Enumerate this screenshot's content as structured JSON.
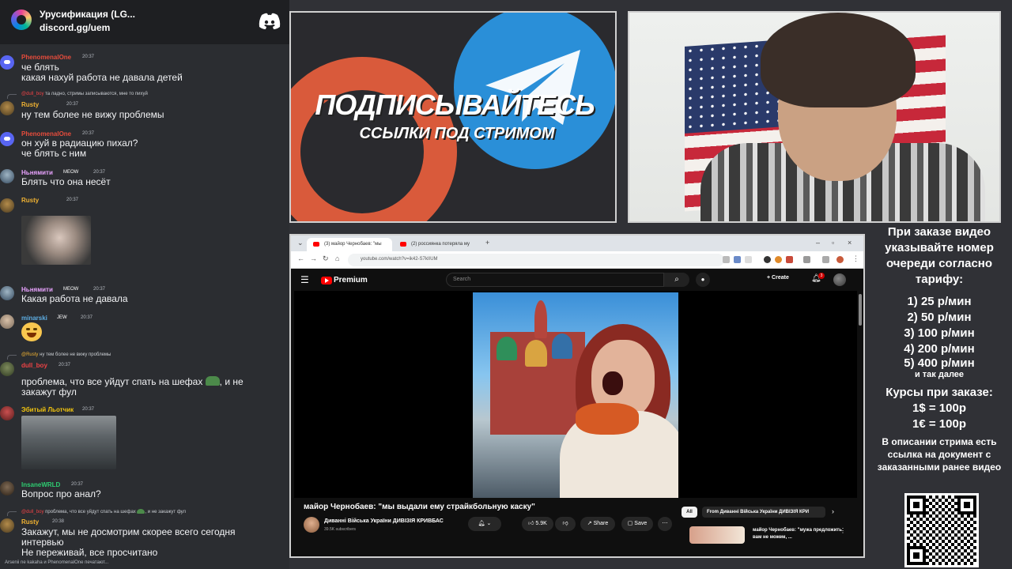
{
  "chat": {
    "server_name": "Урусификация (LG...",
    "server_link": "discord.gg/uem",
    "messages": [
      {
        "user": "PhenomenalOne",
        "time": "20:37",
        "lines": "че блять\nкакая нахуй работа не давала детей"
      },
      {
        "reply_user": "@dull_boy",
        "reply_text": "та ладно, стримы записываются, мне то пихуй",
        "user": "Rusty",
        "time": "20:37",
        "lines": "ну тем более не вижу проблемы"
      },
      {
        "user": "PhenomenalOne",
        "time": "20:37",
        "lines": "он хуй в радиацию пихал?\nче блять с ним"
      },
      {
        "user": "Ньнямити",
        "badge": "MEOW",
        "time": "20:37",
        "lines": "Блять что она несёт"
      },
      {
        "user": "Rusty",
        "time": "20:37"
      },
      {
        "user": "Ньнямити",
        "badge": "MEOW",
        "time": "20:37",
        "lines": "Какая работа не давала"
      },
      {
        "user": "minarski",
        "badge": "JEW",
        "time": "20:37"
      },
      {
        "reply_user": "@Rusty",
        "reply_text": "ну тем более не вижу проблемы",
        "user": "dull_boy",
        "time": "20:37",
        "lines": "проблема, что все уйдут спать на шефах",
        "lines_tail": ", и не\nзакажут фул"
      },
      {
        "user": "Эбитый Льотчик",
        "time": "20:37"
      },
      {
        "user": "InsaneWRLD",
        "time": "20:37",
        "lines": "Вопрос про анал?"
      },
      {
        "reply_user": "@dull_boy",
        "reply_text": "проблема, что все уйдут спать на шефах",
        "reply_tail": ", и не закажут фул",
        "user": "Rusty",
        "time": "20:38",
        "lines": "Закажут, мы не досмотрим скорее всего сегодня\nинтервью\nНе переживай, все просчитано"
      }
    ],
    "typing": "Arsenii ne kakaha и PhenomenalOne печатают..."
  },
  "promo": {
    "title": "ПОДПИСЫВАЙТЕСЬ",
    "subtitle": "ССЫЛКИ ПОД СТРИМОМ"
  },
  "browser": {
    "tabs": [
      {
        "label": "(3) майор Чернобаев: \"мы"
      },
      {
        "label": "(2) россиянка потеряла му"
      }
    ],
    "url": "youtube.com/watch?v=ik42-S7kIIUM",
    "yt": {
      "logo": "Premium",
      "search_placeholder": "Search",
      "create": "Create",
      "bell_count": "3",
      "video_title": "майор Чернобаев: \"мы выдали ему страйкбольную каску\"",
      "channel": "Диванні Війська України ДИВІЗІЯ КРИВБАС",
      "subscribers": "39.5K subscribers",
      "likes": "5.9K",
      "share": "Share",
      "save": "Save",
      "chip_all": "All",
      "chip_from": "From Диванні Війська України ДИВІЗІЯ КРИ",
      "rec_title": "майор Чернобаев: \"мужа предложить вам не можем, ..."
    }
  },
  "info": {
    "order_note": "При заказе видео указывайте номер очереди согласно тарифу:",
    "tariffs": [
      "1) 25 р/мин",
      "2) 50 р/мин",
      "3) 100 р/мин",
      "4) 200 р/мин",
      "5) 400 р/мин"
    ],
    "etc": "и так далее",
    "rates_title": "Курсы при заказе:",
    "rate1": "1$ = 100р",
    "rate2": "1€ = 100р",
    "desc_note": "В описании стрима есть ссылка на документ с заказанными ранее видео"
  },
  "colors": {
    "discord_bg": "#2b2d31",
    "discord_blurple": "#5865f2",
    "yt_red": "#ff0000",
    "phenomenal": "#e74c3c",
    "rusty": "#f0b232",
    "nyam": "#e9a3ff",
    "minarski": "#5dade2",
    "dull": "#ed4245",
    "lvov": "#f1c40f",
    "insane": "#2ecc71"
  }
}
